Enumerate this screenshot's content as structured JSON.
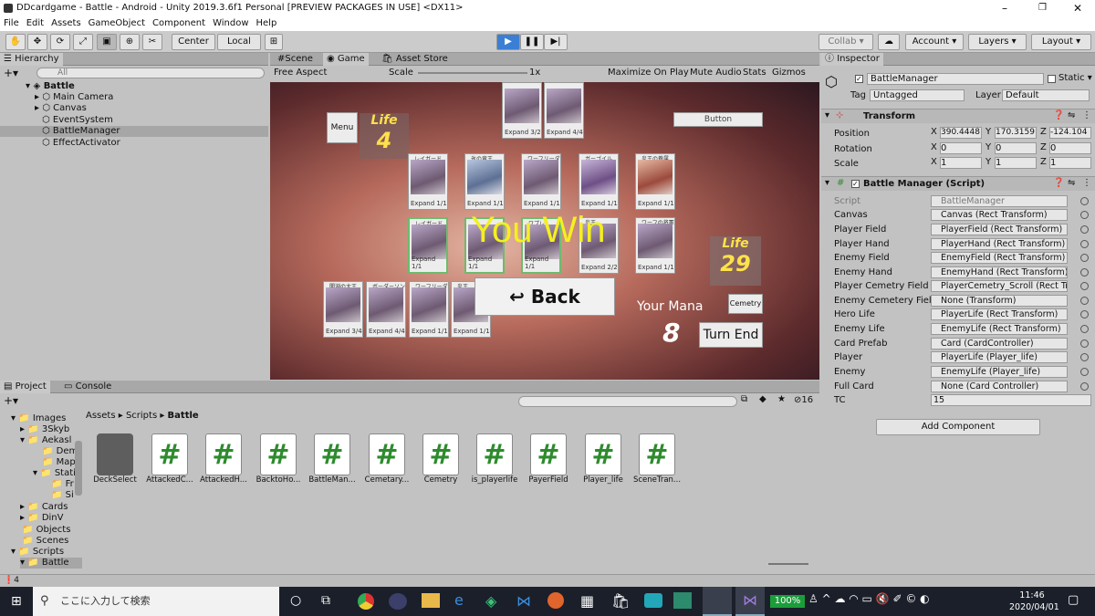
{
  "window": {
    "title": "DDcardgame - Battle - Android - Unity 2019.3.6f1 Personal [PREVIEW PACKAGES IN USE] <DX11>"
  },
  "menu": [
    "File",
    "Edit",
    "Assets",
    "GameObject",
    "Component",
    "Window",
    "Help"
  ],
  "toolbar": {
    "center": "Center",
    "local": "Local",
    "collab": "Collab",
    "account": "Account",
    "layers": "Layers",
    "layout": "Layout"
  },
  "hierarchy": {
    "tab": "Hierarchy",
    "search": "All",
    "scene": "Battle",
    "items": [
      "Main Camera",
      "Canvas",
      "EventSystem",
      "BattleManager",
      "EffectActivator"
    ]
  },
  "game": {
    "tabs": [
      "Scene",
      "Game",
      "Asset Store"
    ],
    "aspect": "Free Aspect",
    "scale_label": "Scale",
    "scale_value": "1x",
    "options": [
      "Maximize On Play",
      "Mute Audio",
      "Stats",
      "Gizmos"
    ]
  },
  "game_ui": {
    "menu": "Menu",
    "life_label": "Life",
    "enemy_life": "4",
    "button": "Button",
    "player_life_label": "Life",
    "player_life": "29",
    "you_win": "You Win",
    "back": "Back",
    "your_mana": "Your Mana",
    "mana": "8",
    "cemetery": "Cemetry",
    "turn_end": "Turn End",
    "expand": "Expand",
    "enemy_hand": [
      {
        "name": "",
        "cost": "3/2"
      },
      {
        "name": "",
        "cost": "4/4"
      }
    ],
    "enemy_field": [
      {
        "name": "レイガード",
        "stats": "1/1"
      },
      {
        "name": "氷の竜王",
        "stats": "1/1"
      },
      {
        "name": "ワーフリーダ",
        "stats": "1/1"
      },
      {
        "name": "ガーゴイル",
        "stats": "1/1"
      },
      {
        "name": "炎王の眷属",
        "stats": "1/1"
      }
    ],
    "player_field": [
      {
        "name": "レイガード",
        "stats": "1/1"
      },
      {
        "name": "",
        "stats": "1/1"
      },
      {
        "name": "ワプレ",
        "stats": "1/1"
      },
      {
        "name": "炎王",
        "stats": "2/2"
      },
      {
        "name": "ワーフの将軍",
        "stats": "1/1"
      }
    ],
    "player_hand": [
      {
        "name": "闇淵の大王",
        "stats": "3/4"
      },
      {
        "name": "ボーダーソン",
        "stats": "4/4"
      },
      {
        "name": "ワーフリーダ",
        "stats": "1/1"
      },
      {
        "name": "炎王",
        "stats": "1/1"
      }
    ]
  },
  "project": {
    "tabs": [
      "Project",
      "Console"
    ],
    "folders": [
      "Images",
      "3Skyb",
      "Aekasl",
      "Dem",
      "Map",
      "Stati",
      "Fr",
      "Si",
      "Cards",
      "DinV",
      "Objects",
      "Scenes",
      "Scripts",
      "Battle"
    ],
    "breadcrumb": [
      "Assets",
      "Scripts",
      "Battle"
    ],
    "count": "16",
    "assets": [
      "DeckSelect",
      "AttackedC...",
      "AttackedH...",
      "BacktoHo...",
      "BattleMan...",
      "Cemetary...",
      "Cemetry",
      "is_playerlife",
      "PayerField",
      "Player_life",
      "SceneTran..."
    ]
  },
  "inspector": {
    "tab": "Inspector",
    "object": "BattleManager",
    "static": "Static",
    "tag_label": "Tag",
    "tag": "Untagged",
    "layer_label": "Layer",
    "layer": "Default",
    "transform": "Transform",
    "position": {
      "label": "Position",
      "x": "390.4448",
      "y": "170.3159",
      "z": "-124.104"
    },
    "rotation": {
      "label": "Rotation",
      "x": "0",
      "y": "0",
      "z": "0"
    },
    "scale": {
      "label": "Scale",
      "x": "1",
      "y": "1",
      "z": "1"
    },
    "script_header": "Battle Manager (Script)",
    "fields": [
      [
        "Script",
        "BattleManager"
      ],
      [
        "Canvas",
        "Canvas (Rect Transform)"
      ],
      [
        "Player Field",
        "PlayerField (Rect Transform)"
      ],
      [
        "Player Hand",
        "PlayerHand (Rect Transform)"
      ],
      [
        "Enemy Field",
        "EnemyField (Rect Transform)"
      ],
      [
        "Enemy Hand",
        "EnemyHand (Rect Transform)"
      ],
      [
        "Player Cemetry Field",
        "PlayerCemetry_Scroll (Rect Trans"
      ],
      [
        "Enemy Cemetery Field",
        "None (Transform)"
      ],
      [
        "Hero Life",
        "PlayerLife (Rect Transform)"
      ],
      [
        "Enemy Life",
        "EnemyLife (Rect Transform)"
      ],
      [
        "Card Prefab",
        "Card (CardController)"
      ],
      [
        "Player",
        "PlayerLife (Player_life)"
      ],
      [
        "Enemy",
        "EnemyLife (Player_life)"
      ],
      [
        "Full Card",
        "None (Card Controller)"
      ],
      [
        "TC",
        "15"
      ]
    ],
    "add_component": "Add Component"
  },
  "status": {
    "count": "4"
  },
  "taskbar": {
    "search": "ここに入力して検索",
    "battery": "100%",
    "time": "11:46",
    "date": "2020/04/01"
  }
}
